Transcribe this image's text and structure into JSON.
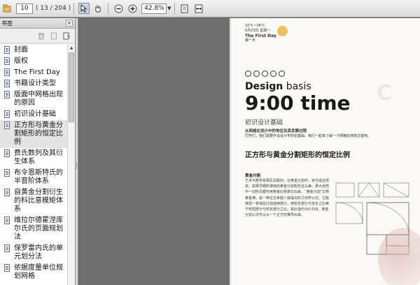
{
  "toolbar": {
    "page_input": "10",
    "page_count": "( 13 / 204 )",
    "zoom": "42.8%",
    "zoom_dropdown": "▼"
  },
  "sidebar": {
    "title": "书签",
    "close": "×",
    "scroll_up": "▲",
    "items": [
      {
        "label": "封面"
      },
      {
        "label": "版权"
      },
      {
        "label": "The First Day"
      },
      {
        "label": "书籍设计类型"
      },
      {
        "label": "版面中网格出现的原因"
      },
      {
        "label": "初识设计基础"
      },
      {
        "label": "正方形与黄金分割矩形的恒定比例"
      },
      {
        "label": "费氏数列及其衍生体系"
      },
      {
        "label": "布令恩斯特氏的半音阶体系"
      },
      {
        "label": "自黄金分割衍生的科比意模矩体系"
      },
      {
        "label": "维拉尔德霍涅库尔氏的页面规划法"
      },
      {
        "label": "保罗雷内氏的单元划分法"
      },
      {
        "label": "依据度量单位规划网格"
      }
    ]
  },
  "page": {
    "run_head_line1": "32°C~36°C",
    "run_head_line2": "6月23日 星期一",
    "run_head_title": "The First Day",
    "run_head_cn": "第一天",
    "design_word": "Design",
    "design_basis": "basis",
    "big_time": "9:00 time",
    "subtitle": "初识设计基础",
    "lead_bold": "从网格在设计中的地位及其发展过程",
    "lead_text": "同学们，我们需要开设设计学的初基础。我们一起来了解一下网格的演变过程吧。",
    "section_title": "正方形与黄金分割矩形的恒定比例",
    "subsection": "黄金分割",
    "body": "艺术与数学是相互关联的，在黄金分割中，有句话这样说：如果早期所使用的黄金分割矩形这么美，那大自然中一切所见都可用黄金比例表达出来。“黄金分割”又称黄金律，是一种在古希腊人就提出的几何学公式，它能够把一条线段分割成两部分，使较长部分与全长之比等于较短部分与较长部分之比，其比值约为0.618。黄金分割公式可以从一个正方形推导出来。"
  }
}
